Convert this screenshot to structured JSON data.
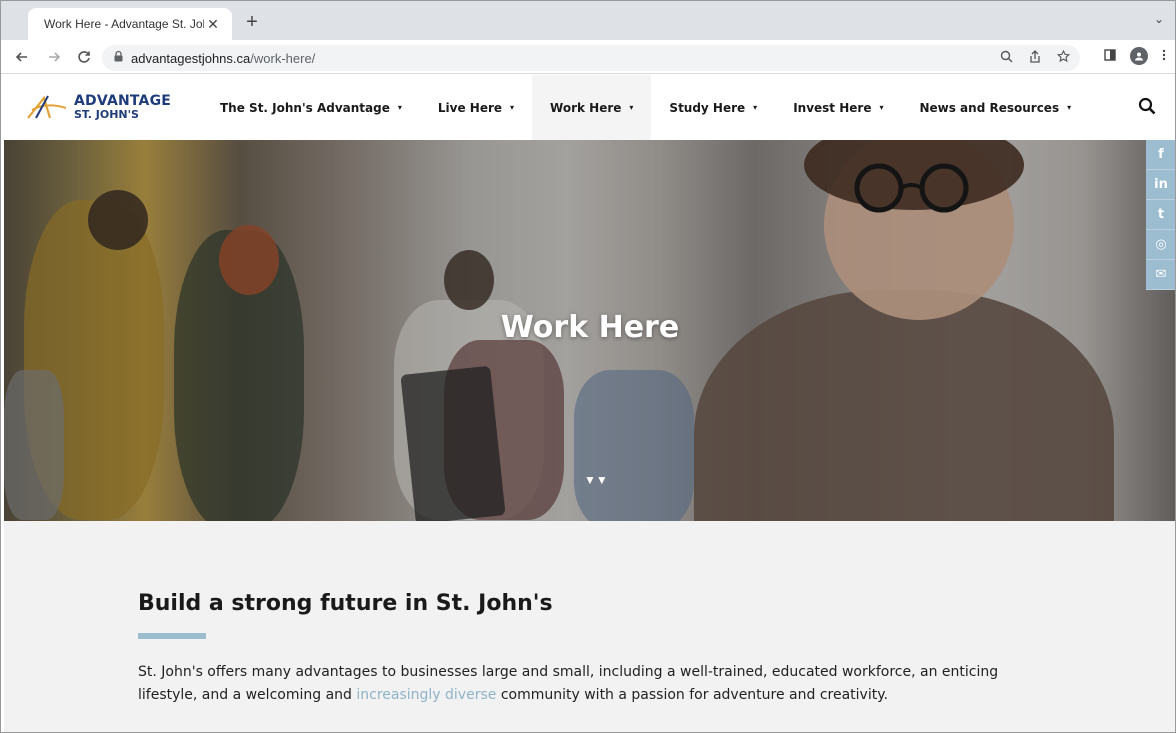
{
  "browser": {
    "tab_title": "Work Here - Advantage St. John",
    "tab_close": "✕",
    "new_tab": "+",
    "tab_list": "⌄",
    "url_host": "advantagestjohns.ca",
    "url_path": "/work-here/"
  },
  "site": {
    "logo_main": "ADVANTAGE",
    "logo_sub": "ST. JOHN'S",
    "nav": [
      {
        "label": "The St. John's Advantage"
      },
      {
        "label": "Live Here"
      },
      {
        "label": "Work Here"
      },
      {
        "label": "Study Here"
      },
      {
        "label": "Invest Here"
      },
      {
        "label": "News and Resources"
      }
    ],
    "caret": "▾"
  },
  "hero": {
    "title": "Work Here",
    "arrows": "▼▼"
  },
  "social": {
    "facebook": "f",
    "linkedin": "in",
    "twitter": "t",
    "instagram": "◎",
    "email": "✉"
  },
  "content": {
    "heading": "Build a strong future in St. John's",
    "para_before": "St. John's offers many advantages to businesses large and small, including a well-trained, educated workforce, an enticing lifestyle, and a welcoming and ",
    "para_link": "increasingly diverse",
    "para_after": " community with a passion for adventure and creativity."
  },
  "colors": {
    "brand_blue": "#1f3c7a",
    "accent_light_blue": "#9cbcd0",
    "link_blue": "#8fb3c9"
  }
}
